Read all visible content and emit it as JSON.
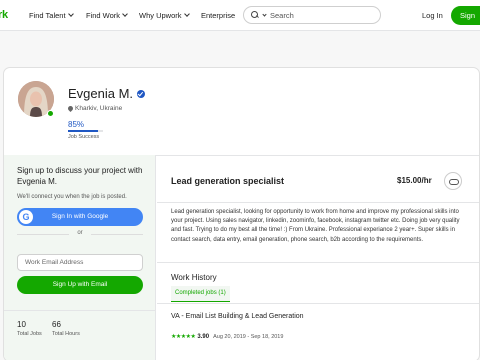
{
  "colors": {
    "brand": "#14a800",
    "accent_blue": "#1f57c3",
    "google_blue": "#4285f4"
  },
  "nav": {
    "logo": "rk",
    "links": [
      {
        "label": "Find Talent"
      },
      {
        "label": "Find Work"
      },
      {
        "label": "Why Upwork"
      },
      {
        "label": "Enterprise"
      }
    ],
    "search": {
      "placeholder": "Search"
    },
    "login_label": "Log In",
    "signup_label": "Sign"
  },
  "profile": {
    "name": "Evgenia M.",
    "location": "Kharkiv, Ukraine",
    "job_success": {
      "value": "85%",
      "fraction": 0.85,
      "label": "Job Success"
    }
  },
  "signup_panel": {
    "title": "Sign up to discuss your project with Evgenia M.",
    "note": "We'll connect you when the job is posted.",
    "google_label": "Sign In with Google",
    "or_label": "or",
    "email_placeholder": "Work Email Address",
    "email_button_label": "Sign Up with Email"
  },
  "stats": [
    {
      "value": "10",
      "label": "Total Jobs"
    },
    {
      "value": "66",
      "label": "Total Hours"
    }
  ],
  "overview": {
    "title": "Lead generation specialist",
    "rate": "$15.00/hr",
    "description": "Lead generation specialist, looking for opportunity to work from home and improve my professional skills into your project. Using sales navigator, linkedin, zoominfo, facebook, instagram twitter etc. Doing job very quality and fast. Trying to do my best all the time! :) From Ukraine. Professional experiance 2 year+. Super skills in contact search, data entry, email generation, phone search, b2b according to the requirements."
  },
  "work_history": {
    "title": "Work History",
    "tab_label": "Completed jobs (1)",
    "jobs": [
      {
        "title": "VA - Email List Building & Lead Generation",
        "stars": "★★★★★",
        "score": "3.90",
        "dates": "Aug 20, 2019 - Sep 18, 2019"
      }
    ]
  }
}
